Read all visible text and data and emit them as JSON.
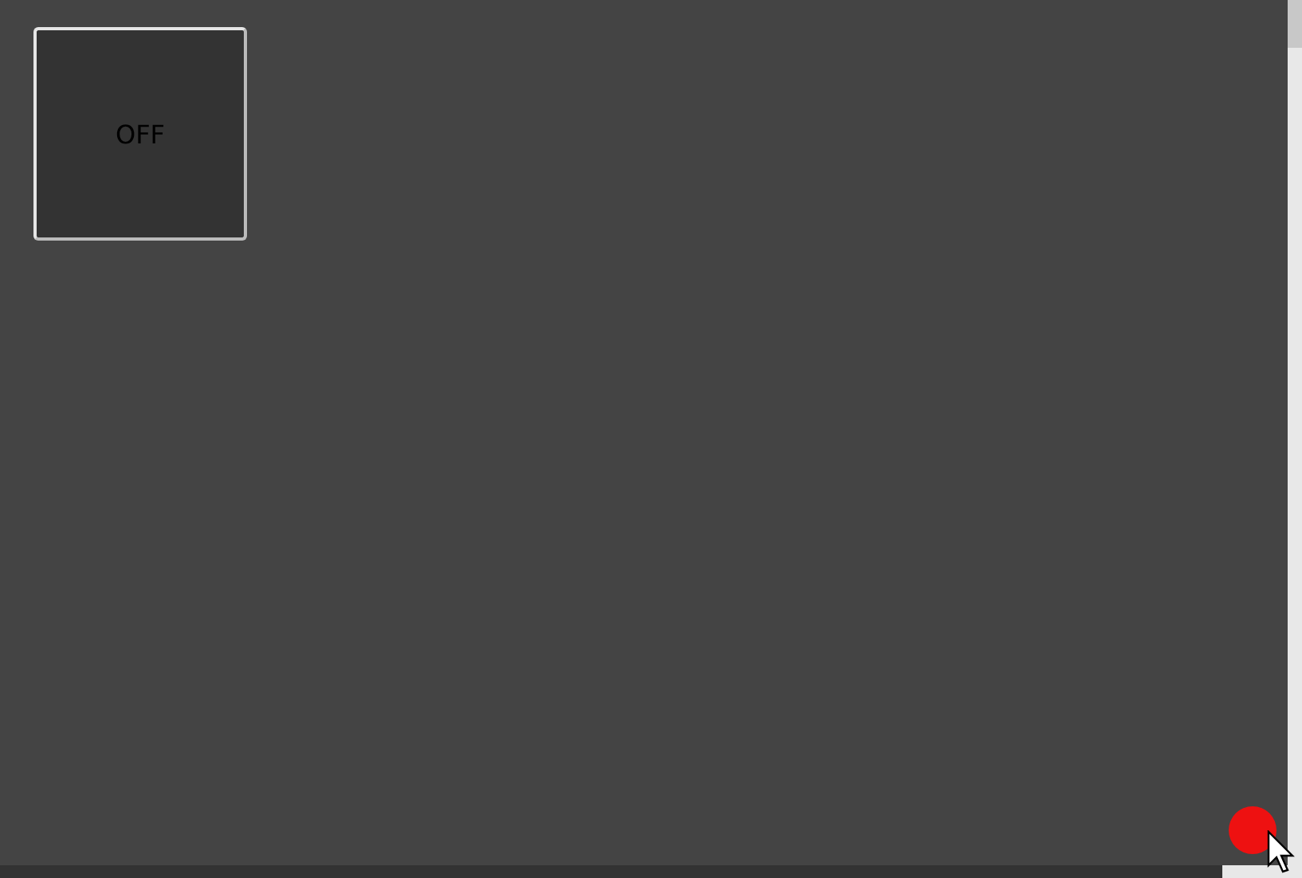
{
  "toggle": {
    "label": "OFF",
    "on": false
  }
}
